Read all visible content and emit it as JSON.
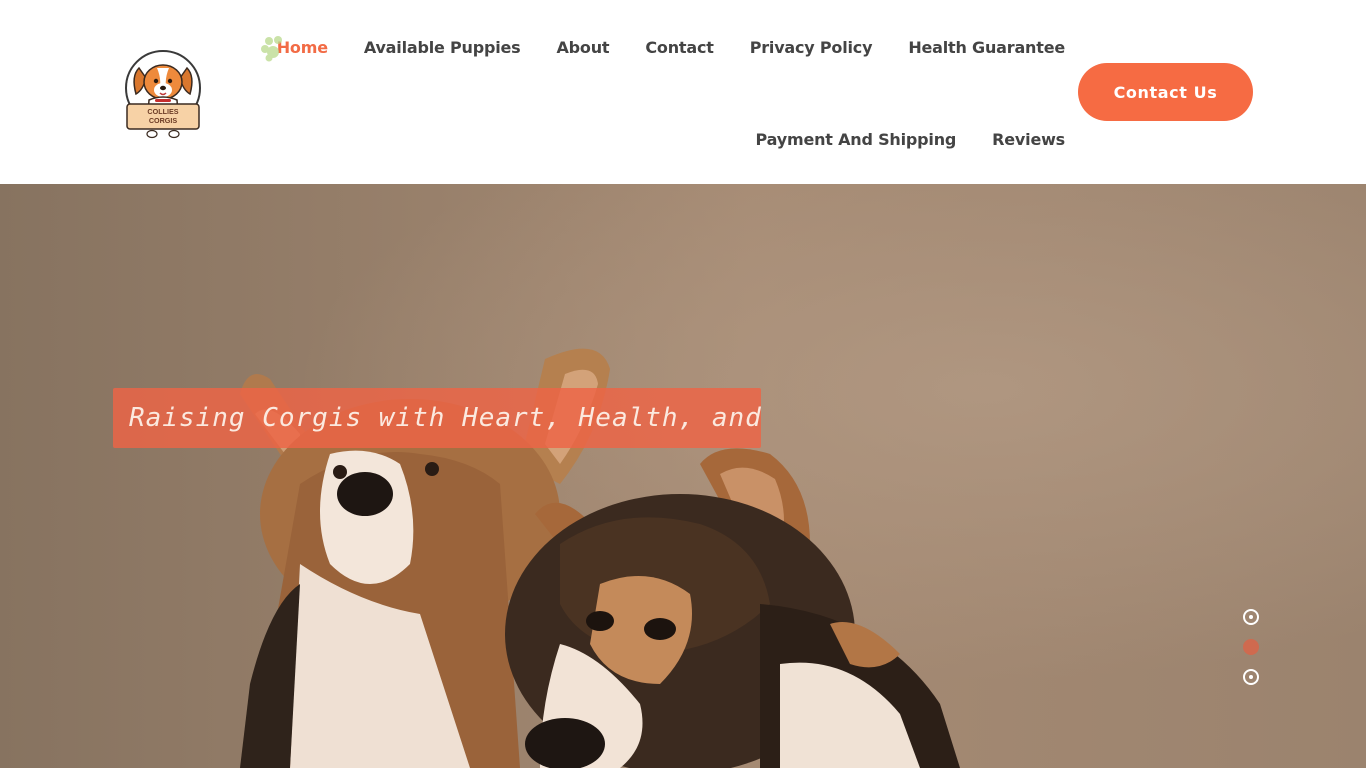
{
  "logo": {
    "text_line1": "COLLIES",
    "text_line2": "CORGIS",
    "icon": "puppy-logo-icon"
  },
  "nav": {
    "items": [
      {
        "label": "Home",
        "active": true
      },
      {
        "label": "Available Puppies"
      },
      {
        "label": "About"
      },
      {
        "label": "Contact"
      },
      {
        "label": "Privacy Policy"
      },
      {
        "label": "Health Guarantee"
      },
      {
        "label": "Payment And Shipping"
      },
      {
        "label": "Reviews"
      }
    ],
    "active_decoration_icon": "paw-icon"
  },
  "header": {
    "cta_label": "Contact Us"
  },
  "hero": {
    "tagline": "Raising Corgis with Heart, Health, and Happiness",
    "image_icon": "corgi-puppies-photo",
    "slides": {
      "count": 3,
      "active_index": 2
    }
  },
  "colors": {
    "accent": "#f66b43",
    "nav_text": "#444444",
    "active_nav": "#f26b45",
    "hero_bg": "#9c846f"
  }
}
